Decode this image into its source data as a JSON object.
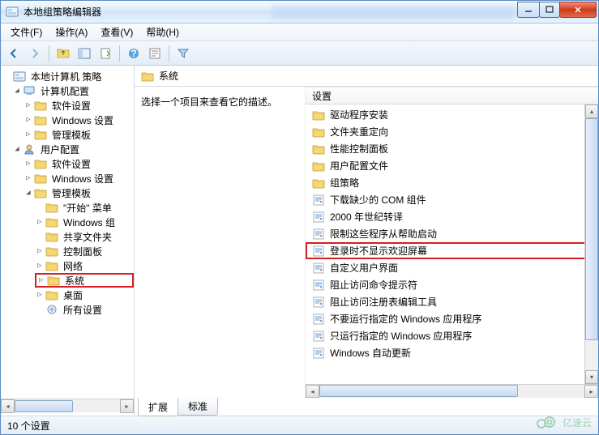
{
  "window": {
    "title": "本地组策略编辑器"
  },
  "menu": {
    "file": "文件(F)",
    "action": "操作(A)",
    "view": "查看(V)",
    "help": "帮助(H)"
  },
  "tree": {
    "root": "本地计算机 策略",
    "computer_config": "计算机配置",
    "software_settings": "软件设置",
    "windows_settings": "Windows 设置",
    "admin_templates": "管理模板",
    "user_config": "用户配置",
    "start_menu": "\"开始\" 菜单",
    "windows_components": "Windows 组",
    "shared_folders": "共享文件夹",
    "control_panel": "控制面板",
    "network": "网络",
    "system": "系统",
    "desktop": "桌面",
    "all_settings": "所有设置"
  },
  "main": {
    "header": "系统",
    "prompt": "选择一个项目来查看它的描述。",
    "column_header": "设置",
    "items": [
      {
        "type": "folder",
        "label": "驱动程序安装"
      },
      {
        "type": "folder",
        "label": "文件夹重定向"
      },
      {
        "type": "folder",
        "label": "性能控制面板"
      },
      {
        "type": "folder",
        "label": "用户配置文件"
      },
      {
        "type": "folder",
        "label": "组策略"
      },
      {
        "type": "policy",
        "label": "下载缺少的 COM 组件"
      },
      {
        "type": "policy",
        "label": "2000 年世纪转译"
      },
      {
        "type": "policy",
        "label": "限制这些程序从帮助启动"
      },
      {
        "type": "policy",
        "label": "登录时不显示欢迎屏幕",
        "highlight": true
      },
      {
        "type": "policy",
        "label": "自定义用户界面"
      },
      {
        "type": "policy",
        "label": "阻止访问命令提示符"
      },
      {
        "type": "policy",
        "label": "阻止访问注册表编辑工具"
      },
      {
        "type": "policy",
        "label": "不要运行指定的 Windows 应用程序"
      },
      {
        "type": "policy",
        "label": "只运行指定的 Windows 应用程序"
      },
      {
        "type": "policy",
        "label": "Windows 自动更新"
      }
    ],
    "tabs": {
      "extended": "扩展",
      "standard": "标准"
    }
  },
  "status": {
    "text": "10 个设置"
  },
  "watermark": "亿速云"
}
